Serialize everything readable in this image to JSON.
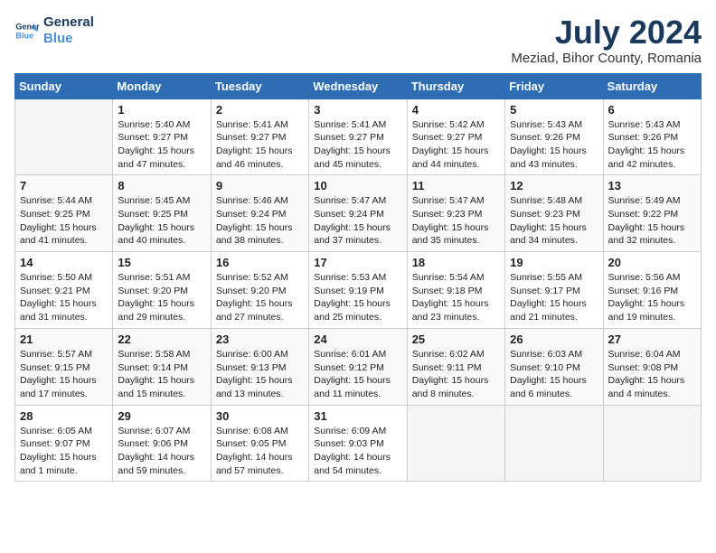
{
  "logo": {
    "line1": "General",
    "line2": "Blue"
  },
  "title": "July 2024",
  "subtitle": "Meziad, Bihor County, Romania",
  "days_header": [
    "Sunday",
    "Monday",
    "Tuesday",
    "Wednesday",
    "Thursday",
    "Friday",
    "Saturday"
  ],
  "weeks": [
    [
      {
        "day": "",
        "content": ""
      },
      {
        "day": "1",
        "content": "Sunrise: 5:40 AM\nSunset: 9:27 PM\nDaylight: 15 hours\nand 47 minutes."
      },
      {
        "day": "2",
        "content": "Sunrise: 5:41 AM\nSunset: 9:27 PM\nDaylight: 15 hours\nand 46 minutes."
      },
      {
        "day": "3",
        "content": "Sunrise: 5:41 AM\nSunset: 9:27 PM\nDaylight: 15 hours\nand 45 minutes."
      },
      {
        "day": "4",
        "content": "Sunrise: 5:42 AM\nSunset: 9:27 PM\nDaylight: 15 hours\nand 44 minutes."
      },
      {
        "day": "5",
        "content": "Sunrise: 5:43 AM\nSunset: 9:26 PM\nDaylight: 15 hours\nand 43 minutes."
      },
      {
        "day": "6",
        "content": "Sunrise: 5:43 AM\nSunset: 9:26 PM\nDaylight: 15 hours\nand 42 minutes."
      }
    ],
    [
      {
        "day": "7",
        "content": "Sunrise: 5:44 AM\nSunset: 9:25 PM\nDaylight: 15 hours\nand 41 minutes."
      },
      {
        "day": "8",
        "content": "Sunrise: 5:45 AM\nSunset: 9:25 PM\nDaylight: 15 hours\nand 40 minutes."
      },
      {
        "day": "9",
        "content": "Sunrise: 5:46 AM\nSunset: 9:24 PM\nDaylight: 15 hours\nand 38 minutes."
      },
      {
        "day": "10",
        "content": "Sunrise: 5:47 AM\nSunset: 9:24 PM\nDaylight: 15 hours\nand 37 minutes."
      },
      {
        "day": "11",
        "content": "Sunrise: 5:47 AM\nSunset: 9:23 PM\nDaylight: 15 hours\nand 35 minutes."
      },
      {
        "day": "12",
        "content": "Sunrise: 5:48 AM\nSunset: 9:23 PM\nDaylight: 15 hours\nand 34 minutes."
      },
      {
        "day": "13",
        "content": "Sunrise: 5:49 AM\nSunset: 9:22 PM\nDaylight: 15 hours\nand 32 minutes."
      }
    ],
    [
      {
        "day": "14",
        "content": "Sunrise: 5:50 AM\nSunset: 9:21 PM\nDaylight: 15 hours\nand 31 minutes."
      },
      {
        "day": "15",
        "content": "Sunrise: 5:51 AM\nSunset: 9:20 PM\nDaylight: 15 hours\nand 29 minutes."
      },
      {
        "day": "16",
        "content": "Sunrise: 5:52 AM\nSunset: 9:20 PM\nDaylight: 15 hours\nand 27 minutes."
      },
      {
        "day": "17",
        "content": "Sunrise: 5:53 AM\nSunset: 9:19 PM\nDaylight: 15 hours\nand 25 minutes."
      },
      {
        "day": "18",
        "content": "Sunrise: 5:54 AM\nSunset: 9:18 PM\nDaylight: 15 hours\nand 23 minutes."
      },
      {
        "day": "19",
        "content": "Sunrise: 5:55 AM\nSunset: 9:17 PM\nDaylight: 15 hours\nand 21 minutes."
      },
      {
        "day": "20",
        "content": "Sunrise: 5:56 AM\nSunset: 9:16 PM\nDaylight: 15 hours\nand 19 minutes."
      }
    ],
    [
      {
        "day": "21",
        "content": "Sunrise: 5:57 AM\nSunset: 9:15 PM\nDaylight: 15 hours\nand 17 minutes."
      },
      {
        "day": "22",
        "content": "Sunrise: 5:58 AM\nSunset: 9:14 PM\nDaylight: 15 hours\nand 15 minutes."
      },
      {
        "day": "23",
        "content": "Sunrise: 6:00 AM\nSunset: 9:13 PM\nDaylight: 15 hours\nand 13 minutes."
      },
      {
        "day": "24",
        "content": "Sunrise: 6:01 AM\nSunset: 9:12 PM\nDaylight: 15 hours\nand 11 minutes."
      },
      {
        "day": "25",
        "content": "Sunrise: 6:02 AM\nSunset: 9:11 PM\nDaylight: 15 hours\nand 8 minutes."
      },
      {
        "day": "26",
        "content": "Sunrise: 6:03 AM\nSunset: 9:10 PM\nDaylight: 15 hours\nand 6 minutes."
      },
      {
        "day": "27",
        "content": "Sunrise: 6:04 AM\nSunset: 9:08 PM\nDaylight: 15 hours\nand 4 minutes."
      }
    ],
    [
      {
        "day": "28",
        "content": "Sunrise: 6:05 AM\nSunset: 9:07 PM\nDaylight: 15 hours\nand 1 minute."
      },
      {
        "day": "29",
        "content": "Sunrise: 6:07 AM\nSunset: 9:06 PM\nDaylight: 14 hours\nand 59 minutes."
      },
      {
        "day": "30",
        "content": "Sunrise: 6:08 AM\nSunset: 9:05 PM\nDaylight: 14 hours\nand 57 minutes."
      },
      {
        "day": "31",
        "content": "Sunrise: 6:09 AM\nSunset: 9:03 PM\nDaylight: 14 hours\nand 54 minutes."
      },
      {
        "day": "",
        "content": ""
      },
      {
        "day": "",
        "content": ""
      },
      {
        "day": "",
        "content": ""
      }
    ]
  ]
}
